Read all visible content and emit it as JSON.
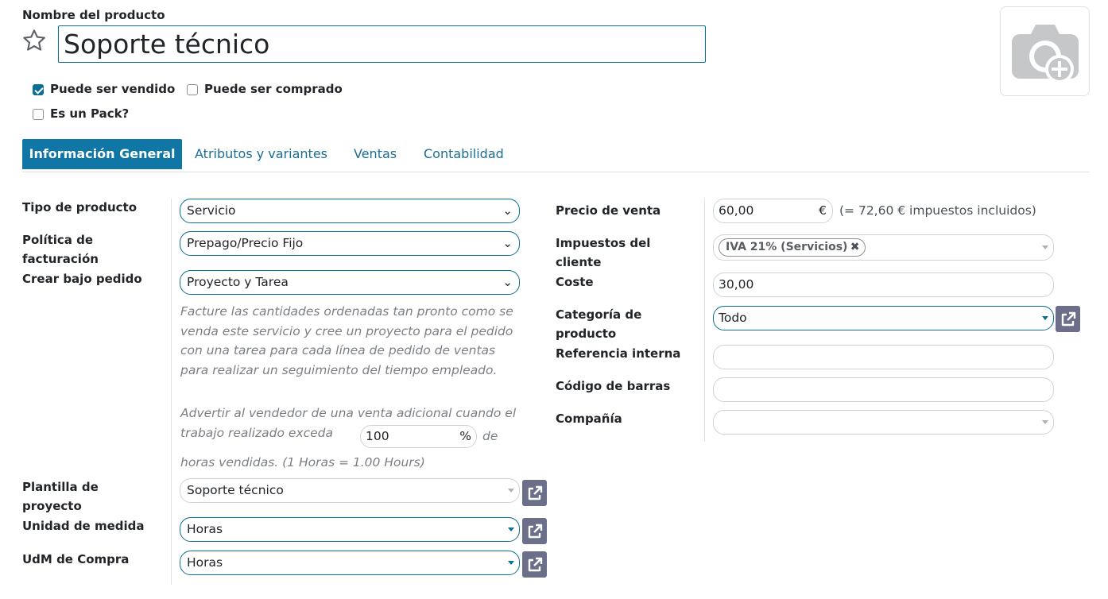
{
  "header": {
    "product_name_label": "Nombre del producto",
    "product_name_value": "Soporte técnico"
  },
  "checkboxes": {
    "can_be_sold": {
      "label": "Puede ser vendido",
      "checked": true
    },
    "can_be_purchased": {
      "label": "Puede ser comprado",
      "checked": false
    },
    "is_pack": {
      "label": "Es un Pack?",
      "checked": false
    }
  },
  "tabs": [
    {
      "label": "Información General",
      "active": true
    },
    {
      "label": "Atributos y variantes",
      "active": false
    },
    {
      "label": "Ventas",
      "active": false
    },
    {
      "label": "Contabilidad",
      "active": false
    }
  ],
  "left": {
    "product_type": {
      "label": "Tipo de producto",
      "value": "Servicio"
    },
    "invoice_policy": {
      "label_line1": "Política de",
      "label_line2": "facturación",
      "value": "Prepago/Precio Fijo"
    },
    "create_on_order": {
      "label": "Crear bajo pedido",
      "value": "Proyecto y Tarea"
    },
    "help_text": "Facture las cantidades ordenadas tan pronto como se venda este servicio y cree un proyecto para el pedido con una tarea para cada línea de pedido de ventas para realizar un seguimiento del tiempo empleado.",
    "upsell_before": "Advertir al vendedor de una venta adicional cuando el trabajo realizado exceda",
    "upsell_value": "100",
    "upsell_unit": "%",
    "upsell_after": "de",
    "upsell_line3": "horas vendidas. (1 Horas = 1.00 Hours)",
    "project_template": {
      "label_line1": "Plantilla de",
      "label_line2": "proyecto",
      "value": "Soporte técnico"
    },
    "uom": {
      "label": "Unidad de medida",
      "value": "Horas"
    },
    "purchase_uom": {
      "label": "UdM de Compra",
      "value": "Horas"
    }
  },
  "right": {
    "sale_price": {
      "label": "Precio de venta",
      "value": "60,00",
      "currency": "€",
      "tax_included": "(= 72,60 € impuestos incluidos)"
    },
    "customer_taxes": {
      "label_line1": "Impuestos del",
      "label_line2": "cliente",
      "tag": "IVA 21% (Servicios)"
    },
    "cost": {
      "label": "Coste",
      "value": "30,00"
    },
    "category": {
      "label_line1": "Categoría de",
      "label_line2": "producto",
      "value": "Todo"
    },
    "internal_ref": {
      "label": "Referencia interna",
      "value": ""
    },
    "barcode": {
      "label": "Código de barras",
      "value": ""
    },
    "company": {
      "label": "Compañía",
      "value": ""
    }
  },
  "colors": {
    "accent": "#0b6e94",
    "tab_active_bg": "#0f76a6",
    "ext_button": "#6b6f8a"
  }
}
